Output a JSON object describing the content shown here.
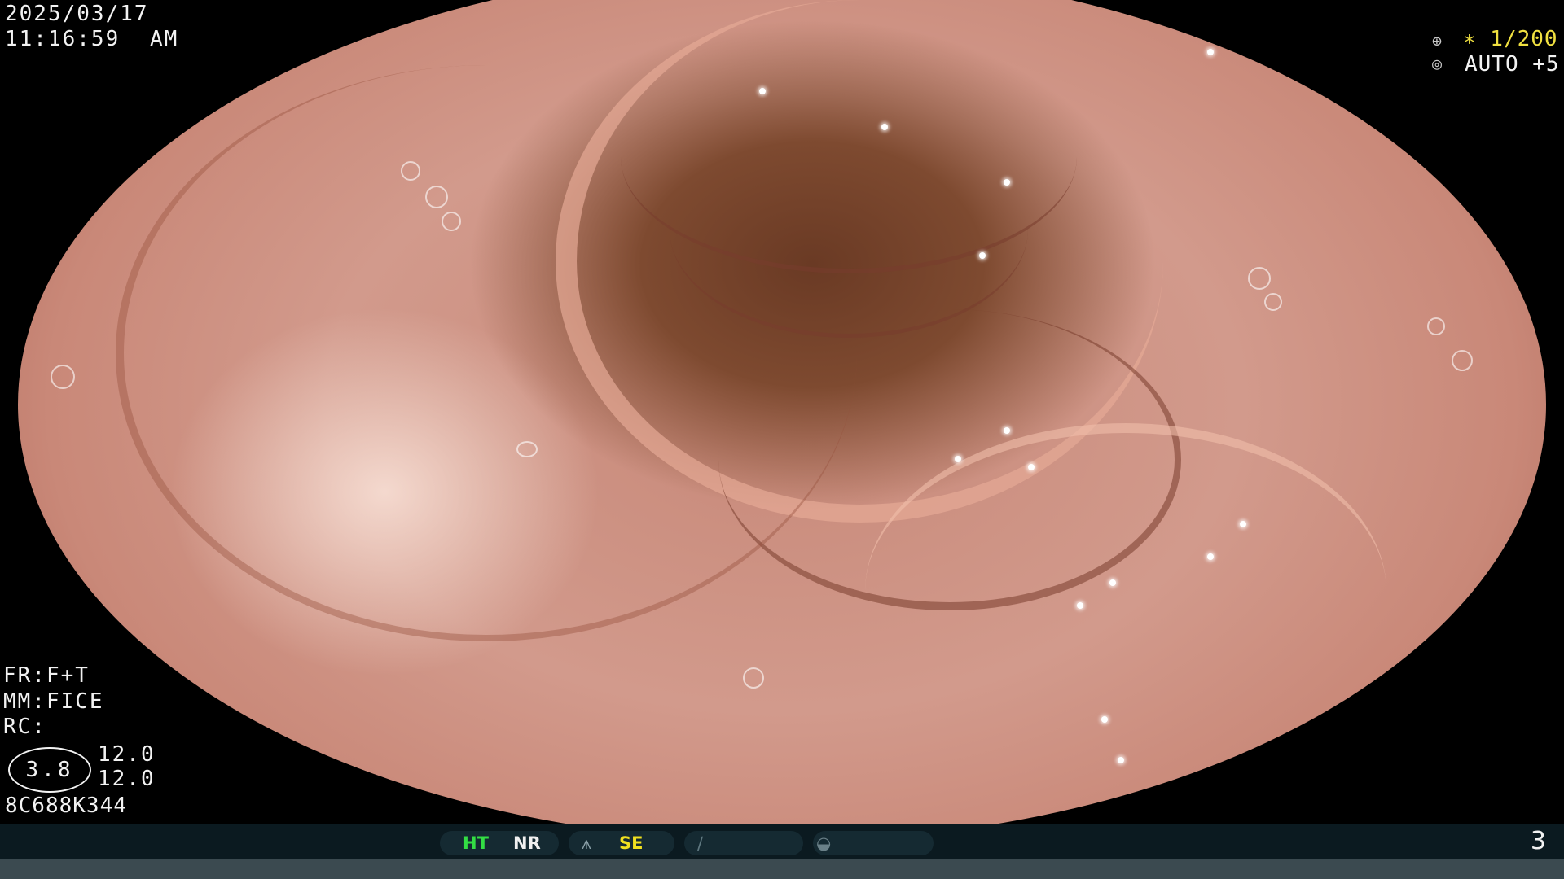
{
  "header": {
    "date": "2025/03/17",
    "time": "11:16:59",
    "meridiem": "AM"
  },
  "exposure": {
    "shutter_label": "∗ 1/200",
    "iris_label": "AUTO +5"
  },
  "settings": {
    "fr": "FR:F+T",
    "mm": "MM:FICE",
    "rc": "RC:",
    "gain_value": "3.8",
    "value_top": "12.0",
    "value_bottom": "12.0",
    "serial": "8C688K344"
  },
  "status_bar": {
    "ht": "HT",
    "nr": "NR",
    "se": "SE",
    "page": "3"
  },
  "colors": {
    "ht": "#33dd44",
    "nr": "#f0f0f0",
    "se": "#f0e020"
  }
}
